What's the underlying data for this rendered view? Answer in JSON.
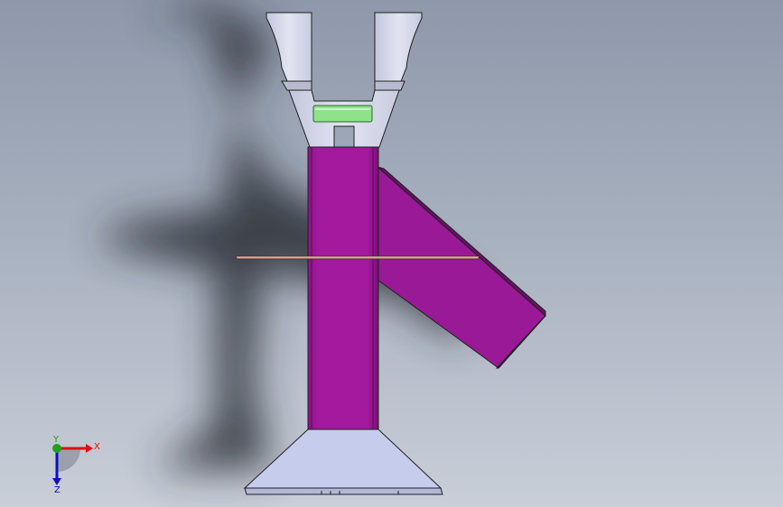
{
  "viewport": {
    "background_top": "#8e98aa",
    "background_bottom": "#c9ced8"
  },
  "model": {
    "body_color": "#a0189c",
    "bracket_color": "#d8dbec",
    "insert_color": "#8ee28a",
    "base_color": "#c6ccec",
    "rod_color": "#d09a8a"
  },
  "triad": {
    "x_label": "X",
    "y_label": "Y",
    "z_label": "Z",
    "x_color": "#e01010",
    "y_color": "#20a020",
    "z_color": "#1010c0"
  }
}
